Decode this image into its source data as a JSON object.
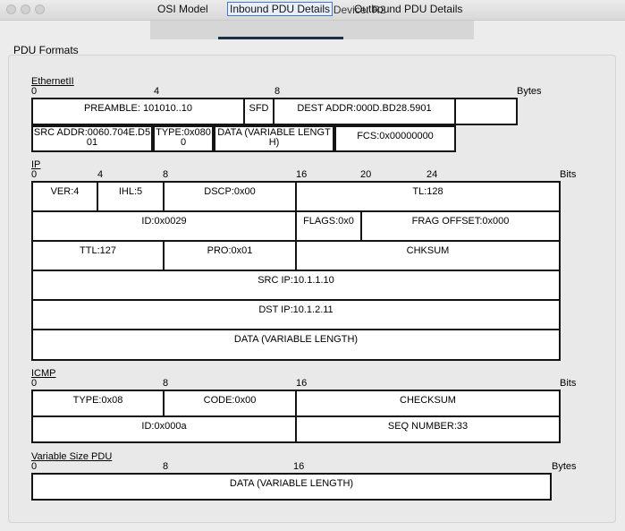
{
  "window": {
    "title": "PDU Information at Device: R2"
  },
  "tabs": [
    {
      "label": "OSI Model"
    },
    {
      "label": "Inbound PDU Details"
    },
    {
      "label": "Outbound PDU Details"
    }
  ],
  "group_label": "PDU Formats",
  "ethernet": {
    "title": "EthernetII",
    "scale": [
      "0",
      "4",
      "8"
    ],
    "unit": "Bytes",
    "preamble": "PREAMBLE: 101010..10",
    "sfd": "SFD",
    "dest_addr": "DEST ADDR:000D.BD28.5901",
    "empty": "",
    "src_addr": "SRC ADDR:0060.704E.D501",
    "type": "TYPE:0x0800",
    "data": "DATA (VARIABLE LENGTH)",
    "fcs": "FCS:0x00000000"
  },
  "ip": {
    "title": "IP",
    "scale": [
      "0",
      "4",
      "8",
      "16",
      "20",
      "24"
    ],
    "unit": "Bits",
    "ver": "VER:4",
    "ihl": "IHL:5",
    "dscp": "DSCP:0x00",
    "tl": "TL:128",
    "id": "ID:0x0029",
    "flags": "FLAGS:0x0",
    "frag_offset": "FRAG OFFSET:0x000",
    "ttl": "TTL:127",
    "pro": "PRO:0x01",
    "chksum": "CHKSUM",
    "src_ip": "SRC IP:10.1.1.10",
    "dst_ip": "DST IP:10.1.2.11",
    "data": "DATA (VARIABLE LENGTH)"
  },
  "icmp": {
    "title": "ICMP",
    "scale": [
      "0",
      "8",
      "16"
    ],
    "unit": "Bits",
    "type": "TYPE:0x08",
    "code": "CODE:0x00",
    "checksum": "CHECKSUM",
    "id": "ID:0x000a",
    "seq": "SEQ NUMBER:33"
  },
  "variable_pdu": {
    "title": "Variable Size PDU",
    "scale": [
      "0",
      "8",
      "16"
    ],
    "unit": "Bytes",
    "data": "DATA (VARIABLE LENGTH)"
  }
}
